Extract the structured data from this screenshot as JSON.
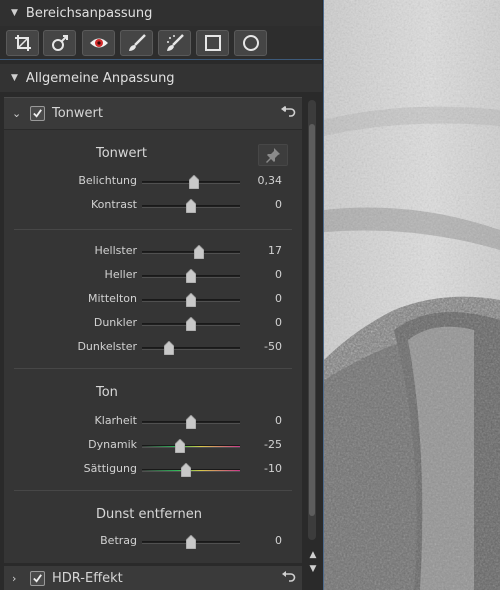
{
  "panel": {
    "area_adjust_title": "Bereichsanpassung",
    "general_adjust_title": "Allgemeine Anpassung",
    "tools": [
      {
        "name": "crop-icon"
      },
      {
        "name": "gender-icon"
      },
      {
        "name": "red-eye-icon"
      },
      {
        "name": "brush-icon"
      },
      {
        "name": "spot-brush-icon"
      },
      {
        "name": "rectangle-icon"
      },
      {
        "name": "circle-icon"
      }
    ]
  },
  "tonwert_section": {
    "header_label": "Tonwert",
    "enabled": true,
    "groups": [
      {
        "title": "Tonwert",
        "rows": [
          {
            "label": "Belichtung",
            "value": "0,34",
            "position": 0.53
          },
          {
            "label": "Kontrast",
            "value": "0",
            "position": 0.5
          }
        ]
      },
      {
        "title": "",
        "rows": [
          {
            "label": "Hellster",
            "value": "17",
            "position": 0.58
          },
          {
            "label": "Heller",
            "value": "0",
            "position": 0.5
          },
          {
            "label": "Mittelton",
            "value": "0",
            "position": 0.5
          },
          {
            "label": "Dunkler",
            "value": "0",
            "position": 0.5
          },
          {
            "label": "Dunkelster",
            "value": "-50",
            "position": 0.28
          }
        ]
      },
      {
        "title": "Ton",
        "rows": [
          {
            "label": "Klarheit",
            "value": "0",
            "position": 0.5
          },
          {
            "label": "Dynamik",
            "value": "-25",
            "position": 0.39,
            "gradient": true
          },
          {
            "label": "Sättigung",
            "value": "-10",
            "position": 0.45,
            "gradient": true
          }
        ]
      },
      {
        "title": "Dunst entfernen",
        "rows": [
          {
            "label": "Betrag",
            "value": "0",
            "position": 0.5
          }
        ]
      }
    ]
  },
  "hdr_section": {
    "header_label": "HDR-Effekt",
    "enabled": true
  },
  "colors": {
    "accent": "#4d6a8c",
    "panel_bg": "#2a2a2a",
    "section_bg": "#353535"
  }
}
